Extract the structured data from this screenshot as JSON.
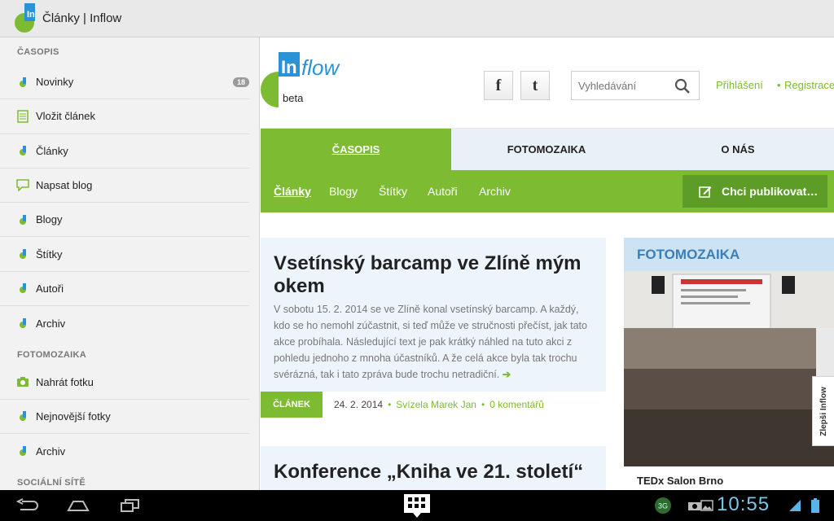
{
  "app": {
    "title": "Články | Inflow"
  },
  "drawer": {
    "sections": [
      {
        "heading": "ČASOPIS",
        "items": [
          {
            "label": "Novinky",
            "icon": "inflow-icon",
            "badge": "18"
          },
          {
            "label": "Vložit článek",
            "icon": "document-icon"
          },
          {
            "label": "Články",
            "icon": "inflow-icon"
          },
          {
            "label": "Napsat blog",
            "icon": "comment-icon"
          },
          {
            "label": "Blogy",
            "icon": "inflow-icon"
          },
          {
            "label": "Štítky",
            "icon": "inflow-icon"
          },
          {
            "label": "Autoři",
            "icon": "inflow-icon"
          },
          {
            "label": "Archiv",
            "icon": "inflow-icon"
          }
        ]
      },
      {
        "heading": "FOTOMOZAIKA",
        "items": [
          {
            "label": "Nahrát fotku",
            "icon": "camera-icon"
          },
          {
            "label": "Nejnovější fotky",
            "icon": "inflow-icon"
          },
          {
            "label": "Archiv",
            "icon": "inflow-icon"
          }
        ]
      },
      {
        "heading": "SOCIÁLNÍ SÍTĚ",
        "items": []
      }
    ]
  },
  "site": {
    "logo_text": "Inflow",
    "beta": "beta",
    "search_placeholder": "Vyhledávání",
    "login": "Přihlášení",
    "register": "Registrace",
    "bullet": "•",
    "main_nav": [
      "ČASOPIS",
      "FOTOMOZAIKA",
      "O NÁS"
    ],
    "sub_nav": [
      "Články",
      "Blogy",
      "Štítky",
      "Autoři",
      "Archiv"
    ],
    "publish_label": "Chci publikovat…"
  },
  "articles": [
    {
      "title": "Vsetínský barcamp ve Zlíně mým okem",
      "excerpt": "V sobotu 15. 2. 2014 se ve Zlíně konal vsetínský barcamp. A každý, kdo se ho nemohl zúčastnit, si teď může ve stručnosti přečíst, jak tato akce probíhala. Následující text je pak krátký náhled na tuto akci z pohledu jednoho z mnoha účastníků. A že celá akce byla tak trochu svérázná, tak i tato zpráva bude trochu netradiční.",
      "more_arrow": "➔",
      "tag": "ČLÁNEK",
      "date": "24. 2. 2014",
      "author": "Svízela Marek Jan",
      "comments": "0 komentářů"
    },
    {
      "title": "Konference „Kniha ve 21. století“"
    }
  ],
  "fotomozaika": {
    "heading": "FOTOMOZAIKA",
    "caption": "TEDx Salon Brno",
    "feedback": "Zlepši Inflow"
  },
  "system": {
    "clock": "10:55",
    "network": "3G"
  },
  "colors": {
    "accent": "#7dbb32",
    "accent_dark": "#5d9c27",
    "blue": "#2a93d5"
  }
}
